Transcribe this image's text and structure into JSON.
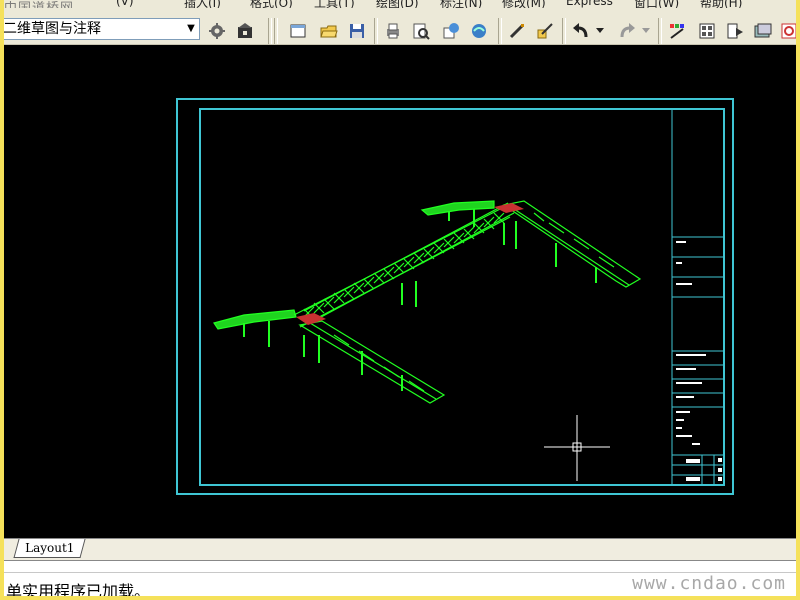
{
  "watermark_top": "中国道桥网",
  "menu": {
    "items": [
      "(V)",
      "插入(I)",
      "格式(O)",
      "工具(T)",
      "绘图(D)",
      "标注(N)",
      "修改(M)",
      "Express",
      "窗口(W)",
      "帮助(H)"
    ]
  },
  "toolbar": {
    "workspace_value": "二维草图与注释",
    "buttons": [
      {
        "name": "workspace-settings-icon"
      },
      {
        "name": "workspace-icon"
      },
      {
        "name": "new-icon"
      },
      {
        "name": "open-icon"
      },
      {
        "name": "save-icon"
      },
      {
        "name": "plot-icon"
      },
      {
        "name": "plot-preview-icon"
      },
      {
        "name": "publish-icon"
      },
      {
        "name": "3d-dwf-icon"
      },
      {
        "name": "match-properties-icon"
      },
      {
        "name": "block-editor-icon"
      },
      {
        "name": "undo-icon"
      },
      {
        "name": "redo-icon"
      },
      {
        "name": "properties-icon"
      },
      {
        "name": "design-center-icon"
      },
      {
        "name": "tool-palettes-icon"
      },
      {
        "name": "sheet-set-icon"
      },
      {
        "name": "markup-icon"
      }
    ]
  },
  "layout_tab": {
    "label": "Layout1"
  },
  "command_line": {
    "text": "单实用程序已加载。"
  },
  "watermark_bottom": "www.cndao.com",
  "colors": {
    "model_space_bg": "#000000",
    "border_cyan": "#3fc6d4",
    "model_green": "#21ff21",
    "model_red": "#c83232",
    "crosshair": "#ffffff",
    "frame_yellow": "#f5e15a"
  }
}
